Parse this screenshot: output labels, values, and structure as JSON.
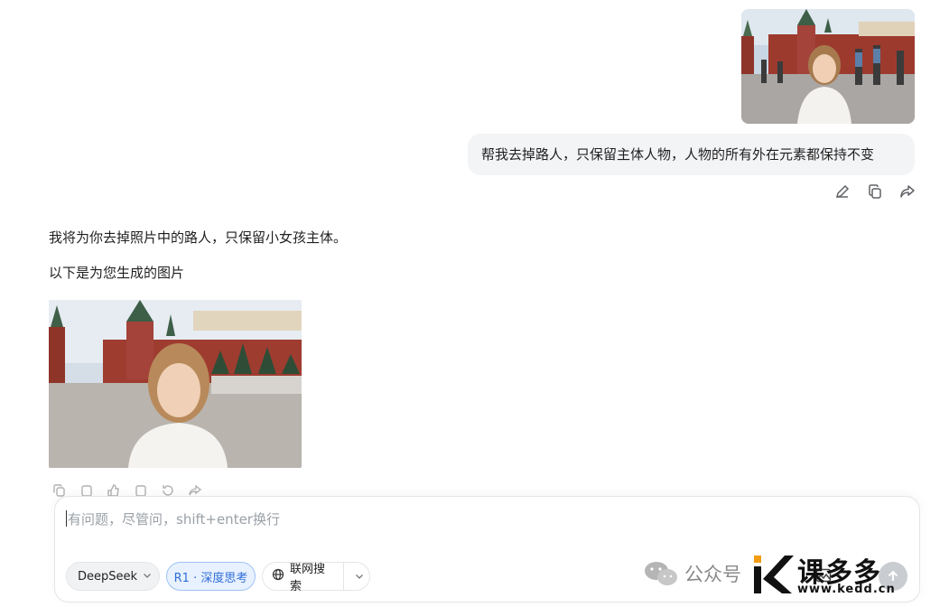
{
  "conversation": {
    "user_message": "帮我去掉路人，只保留主体人物，人物的所有外在元素都保持不变",
    "ai_line1": "我将为你去掉照片中的路人，只保留小女孩主体。",
    "ai_line2": "以下是为您生成的图片"
  },
  "composer": {
    "placeholder": "有问题，尽管问，shift+enter换行",
    "model_label": "DeepSeek",
    "deep_think_label": "R1 · 深度思考",
    "web_search_label": "联网搜索"
  },
  "watermark": {
    "wechat_label": "公众号",
    "brand": "课多多",
    "url": "www.kedd.cn"
  },
  "icons": {
    "edit": "pencil-icon",
    "copy": "copy-icon",
    "share": "share-icon",
    "attach": "image-attach-icon",
    "send": "send-arrow-icon"
  }
}
